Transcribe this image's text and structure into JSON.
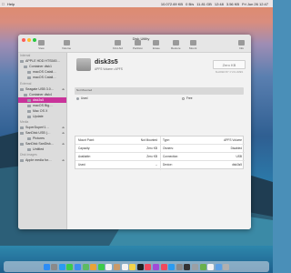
{
  "menubar": {
    "app_name": "Help",
    "status_items": [
      "10.072.69 KB",
      "0 B/s",
      "11.81 GB",
      "12:48",
      "3.56 KB",
      "Fri Jun 26 12:47"
    ]
  },
  "window": {
    "title": "Disk Utility",
    "toolbar": {
      "view_label": "View",
      "volume_label": "Volume",
      "first_aid_label": "First Aid",
      "partition_label": "Partition",
      "erase_label": "Erase",
      "restore_label": "Restore",
      "mount_label": "Mount",
      "info_label": "Info"
    }
  },
  "sidebar": {
    "sections": {
      "internal": "Internal",
      "external": "External",
      "media": "Media",
      "disk_images": "Disk Images"
    },
    "items": [
      {
        "label": "APPLE HDD HTS545…",
        "indent": 0
      },
      {
        "label": "Container disk1",
        "indent": 1
      },
      {
        "label": "macOS Catali…",
        "indent": 2
      },
      {
        "label": "macOS Catali…",
        "indent": 2
      },
      {
        "label": "Seagate USB 3.0…",
        "indent": 0
      },
      {
        "label": "Container disk4",
        "indent": 1
      },
      {
        "label": "disk3s5",
        "indent": 2,
        "selected": true
      },
      {
        "label": "macOS Big…",
        "indent": 2
      },
      {
        "label": "Mac OS X",
        "indent": 2
      },
      {
        "label": "Update",
        "indent": 2
      },
      {
        "label": "SuperDuper!1…",
        "indent": 0
      },
      {
        "label": "SanDisk USB (…",
        "indent": 0
      },
      {
        "label": "Pictures",
        "indent": 1
      },
      {
        "label": "SanDisk SanDisk…",
        "indent": 0
      },
      {
        "label": "Untitled",
        "indent": 1
      },
      {
        "label": "Apple media for…",
        "indent": 0
      }
    ]
  },
  "volume": {
    "name": "disk3s5",
    "subtitle": "APFS Volume • APFS",
    "size": "Zero KB",
    "size_caption": "SHARED BY 4 VOLUMES",
    "bar_label": "Not Mounted",
    "legend": [
      {
        "label": "Used",
        "value": "",
        "color": "#9aa0a6"
      },
      {
        "label": "Free",
        "value": "",
        "color": "#ffffff"
      }
    ]
  },
  "info_table": [
    {
      "k1": "Mount Point:",
      "v1": "Not Mounted",
      "k2": "Type:",
      "v2": "APFS Volume"
    },
    {
      "k1": "Capacity:",
      "v1": "Zero KB",
      "k2": "Owners:",
      "v2": "Disabled"
    },
    {
      "k1": "Available:",
      "v1": "Zero KB",
      "k2": "Connection:",
      "v2": "USB"
    },
    {
      "k1": "Used:",
      "v1": "--",
      "k2": "Device:",
      "v2": "disk3s5"
    }
  ],
  "dock": {
    "apps": [
      "finder",
      "launchpad",
      "safari",
      "messages",
      "mail",
      "maps",
      "photos",
      "facetime",
      "calendar",
      "contacts",
      "reminders",
      "notes",
      "tv",
      "music",
      "podcasts",
      "news",
      "appstore",
      "preferences",
      "terminal",
      "disk-utility",
      "activity",
      "textedit",
      "preview",
      "trash"
    ],
    "colors": [
      "#2d8df5",
      "#8a8a8a",
      "#2a9bf0",
      "#3ccb4a",
      "#3d8ef0",
      "#5dbb62",
      "#e8a33a",
      "#3ccb4a",
      "#f2f2f2",
      "#c99a6a",
      "#f2f2f2",
      "#f3d34a",
      "#222222",
      "#f04a5e",
      "#a04bd8",
      "#f04a5e",
      "#2a9bf0",
      "#8a8a8a",
      "#333333",
      "#9aa0a6",
      "#6ab04c",
      "#f2f2f2",
      "#5aa0e6",
      "#b0b0b0"
    ]
  }
}
